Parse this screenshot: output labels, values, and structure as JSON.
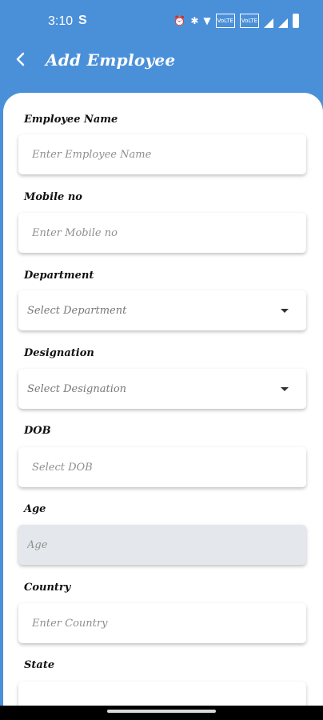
{
  "status_bar": {
    "time": "3:10",
    "sync_glyph": "S",
    "icons": [
      "alarm-icon",
      "bluetooth-icon",
      "wifi-icon",
      "volte-icon",
      "volte-icon",
      "signal-icon",
      "signal-icon",
      "battery-icon"
    ],
    "volte_label": "VoLTE"
  },
  "app_bar": {
    "title": "Add Employee",
    "back_icon": "back-arrow-icon",
    "color": "#4a90d9"
  },
  "form": {
    "employee_name": {
      "label": "Employee Name",
      "placeholder": "Enter Employee Name"
    },
    "mobile": {
      "label": "Mobile no",
      "placeholder": "Enter Mobile no"
    },
    "department": {
      "label": "Department",
      "value": "Select Department"
    },
    "designation": {
      "label": "Designation",
      "value": "Select Designation"
    },
    "dob": {
      "label": "DOB",
      "placeholder": "Select DOB"
    },
    "age": {
      "label": "Age",
      "placeholder": "Age"
    },
    "country": {
      "label": "Country",
      "placeholder": "Enter Country"
    },
    "state": {
      "label": "State"
    }
  }
}
